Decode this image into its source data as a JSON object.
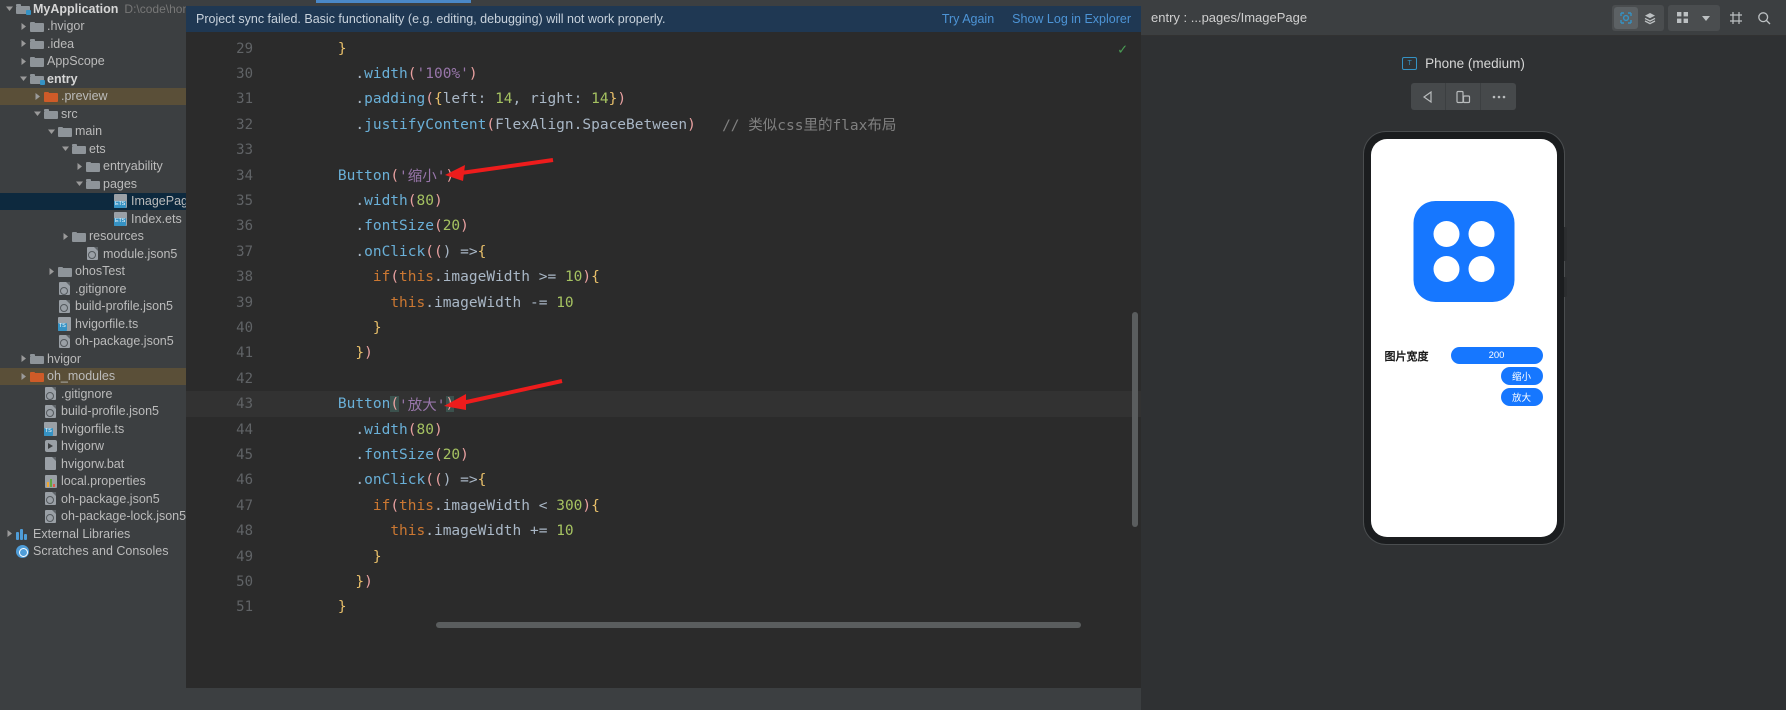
{
  "sidebar": {
    "items": [
      {
        "label": "MyApplication",
        "path": "D:\\code\\hong",
        "icon": "module-folder-icon",
        "indent": 0,
        "arrow": "down",
        "bold": true,
        "state": "none"
      },
      {
        "label": ".hvigor",
        "icon": "folder-icon",
        "indent": 1,
        "arrow": "right",
        "state": "none"
      },
      {
        "label": ".idea",
        "icon": "folder-icon",
        "indent": 1,
        "arrow": "right",
        "state": "none"
      },
      {
        "label": "AppScope",
        "icon": "folder-icon",
        "indent": 1,
        "arrow": "right",
        "state": "none"
      },
      {
        "label": "entry",
        "icon": "module-folder-icon",
        "indent": 1,
        "arrow": "down",
        "bold": true,
        "state": "none"
      },
      {
        "label": ".preview",
        "icon": "folder-orange-icon",
        "indent": 2,
        "arrow": "right",
        "state": "olive"
      },
      {
        "label": "src",
        "icon": "folder-icon",
        "indent": 2,
        "arrow": "down",
        "state": "none"
      },
      {
        "label": "main",
        "icon": "folder-icon",
        "indent": 3,
        "arrow": "down",
        "state": "none"
      },
      {
        "label": "ets",
        "icon": "folder-icon",
        "indent": 4,
        "arrow": "down",
        "state": "none"
      },
      {
        "label": "entryability",
        "icon": "folder-icon",
        "indent": 5,
        "arrow": "right",
        "state": "none"
      },
      {
        "label": "pages",
        "icon": "folder-icon",
        "indent": 5,
        "arrow": "down",
        "state": "none"
      },
      {
        "label": "ImagePage.",
        "icon": "ets-file-icon",
        "indent": 7,
        "arrow": "none",
        "state": "blue"
      },
      {
        "label": "Index.ets",
        "icon": "ets-file-icon",
        "indent": 7,
        "arrow": "none",
        "state": "none"
      },
      {
        "label": "resources",
        "icon": "folder-icon",
        "indent": 4,
        "arrow": "right",
        "state": "none"
      },
      {
        "label": "module.json5",
        "icon": "json5-file-icon",
        "indent": 5,
        "arrow": "none",
        "state": "none"
      },
      {
        "label": "ohosTest",
        "icon": "folder-icon",
        "indent": 3,
        "arrow": "right",
        "state": "none"
      },
      {
        "label": ".gitignore",
        "icon": "gitignore-file-icon",
        "indent": 3,
        "arrow": "none",
        "state": "none"
      },
      {
        "label": "build-profile.json5",
        "icon": "json5-file-icon",
        "indent": 3,
        "arrow": "none",
        "state": "none"
      },
      {
        "label": "hvigorfile.ts",
        "icon": "ts-file-icon",
        "indent": 3,
        "arrow": "none",
        "state": "none"
      },
      {
        "label": "oh-package.json5",
        "icon": "json5-file-icon",
        "indent": 3,
        "arrow": "none",
        "state": "none"
      },
      {
        "label": "hvigor",
        "icon": "folder-icon",
        "indent": 1,
        "arrow": "right",
        "state": "none"
      },
      {
        "label": "oh_modules",
        "icon": "folder-orange-icon",
        "indent": 1,
        "arrow": "right",
        "state": "olive"
      },
      {
        "label": ".gitignore",
        "icon": "gitignore-file-icon",
        "indent": 2,
        "arrow": "none",
        "state": "none"
      },
      {
        "label": "build-profile.json5",
        "icon": "json5-file-icon",
        "indent": 2,
        "arrow": "none",
        "state": "none"
      },
      {
        "label": "hvigorfile.ts",
        "icon": "ts-file-icon",
        "indent": 2,
        "arrow": "none",
        "state": "none"
      },
      {
        "label": "hvigorw",
        "icon": "run-file-icon",
        "indent": 2,
        "arrow": "none",
        "state": "none"
      },
      {
        "label": "hvigorw.bat",
        "icon": "bat-file-icon",
        "indent": 2,
        "arrow": "none",
        "state": "none"
      },
      {
        "label": "local.properties",
        "icon": "properties-file-icon",
        "indent": 2,
        "arrow": "none",
        "state": "none"
      },
      {
        "label": "oh-package.json5",
        "icon": "json5-file-icon",
        "indent": 2,
        "arrow": "none",
        "state": "none"
      },
      {
        "label": "oh-package-lock.json5",
        "icon": "json5-file-icon",
        "indent": 2,
        "arrow": "none",
        "state": "none"
      },
      {
        "label": "External Libraries",
        "icon": "external-libraries-icon",
        "indent": 0,
        "arrow": "right",
        "state": "none"
      },
      {
        "label": "Scratches and Consoles",
        "icon": "scratches-icon",
        "indent": 0,
        "arrow": "none",
        "state": "none"
      }
    ]
  },
  "notification": {
    "message": "Project sync failed. Basic functionality (e.g. editing, debugging) will not work properly.",
    "try_again": "Try Again",
    "show_log": "Show Log in Explorer"
  },
  "editor": {
    "lines": [
      {
        "n": "29",
        "fold": "end",
        "segments": [
          {
            "t": "    ",
            "c": "k-white"
          },
          {
            "t": "}",
            "c": "k-brkt-y"
          }
        ]
      },
      {
        "n": "30",
        "segments": [
          {
            "t": "      .",
            "c": "k-white"
          },
          {
            "t": "width",
            "c": "k-func"
          },
          {
            "t": "(",
            "c": "k-paren"
          },
          {
            "t": "'100%'",
            "c": "k-purple"
          },
          {
            "t": ")",
            "c": "k-paren"
          }
        ]
      },
      {
        "n": "31",
        "segments": [
          {
            "t": "      .",
            "c": "k-white"
          },
          {
            "t": "padding",
            "c": "k-func"
          },
          {
            "t": "(",
            "c": "k-paren"
          },
          {
            "t": "{",
            "c": "k-brkt-y"
          },
          {
            "t": "left",
            "c": "k-white"
          },
          {
            "t": ": ",
            "c": "k-white"
          },
          {
            "t": "14",
            "c": "k-brkt-g"
          },
          {
            "t": ", ",
            "c": "k-white"
          },
          {
            "t": "right",
            "c": "k-white"
          },
          {
            "t": ": ",
            "c": "k-white"
          },
          {
            "t": "14",
            "c": "k-brkt-g"
          },
          {
            "t": "}",
            "c": "k-brkt-y"
          },
          {
            "t": ")",
            "c": "k-paren"
          }
        ]
      },
      {
        "n": "32",
        "segments": [
          {
            "t": "      .",
            "c": "k-white"
          },
          {
            "t": "justifyContent",
            "c": "k-func"
          },
          {
            "t": "(",
            "c": "k-paren"
          },
          {
            "t": "FlexAlign",
            "c": "k-white"
          },
          {
            "t": ".",
            "c": "k-white"
          },
          {
            "t": "SpaceBetween",
            "c": "k-white"
          },
          {
            "t": ")",
            "c": "k-paren"
          },
          {
            "t": "   ",
            "c": "k-white"
          },
          {
            "t": "// 类似css里的flax布局",
            "c": "k-gray"
          }
        ]
      },
      {
        "n": "33",
        "segments": []
      },
      {
        "n": "34",
        "segments": [
          {
            "t": "    ",
            "c": "k-white"
          },
          {
            "t": "Button",
            "c": "k-func"
          },
          {
            "t": "(",
            "c": "k-paren"
          },
          {
            "t": "'缩小'",
            "c": "k-purple"
          },
          {
            "t": ")",
            "c": "k-paren"
          }
        ],
        "arrow": true
      },
      {
        "n": "35",
        "segments": [
          {
            "t": "      .",
            "c": "k-white"
          },
          {
            "t": "width",
            "c": "k-func"
          },
          {
            "t": "(",
            "c": "k-paren"
          },
          {
            "t": "80",
            "c": "k-brkt-g"
          },
          {
            "t": ")",
            "c": "k-paren"
          }
        ]
      },
      {
        "n": "36",
        "segments": [
          {
            "t": "      .",
            "c": "k-white"
          },
          {
            "t": "fontSize",
            "c": "k-func"
          },
          {
            "t": "(",
            "c": "k-paren"
          },
          {
            "t": "20",
            "c": "k-brkt-g"
          },
          {
            "t": ")",
            "c": "k-paren"
          }
        ]
      },
      {
        "n": "37",
        "fold": "start",
        "segments": [
          {
            "t": "      .",
            "c": "k-white"
          },
          {
            "t": "onClick",
            "c": "k-func"
          },
          {
            "t": "((",
            "c": "k-paren"
          },
          {
            "t": ") =>",
            "c": "k-white"
          },
          {
            "t": "{",
            "c": "k-brkt-y"
          }
        ]
      },
      {
        "n": "38",
        "fold": "start",
        "segments": [
          {
            "t": "        ",
            "c": "k-white"
          },
          {
            "t": "if",
            "c": "k-orange"
          },
          {
            "t": "(",
            "c": "k-paren"
          },
          {
            "t": "this",
            "c": "k-orange"
          },
          {
            "t": ".",
            "c": "k-white"
          },
          {
            "t": "imageWidth",
            "c": "k-white"
          },
          {
            "t": " >= ",
            "c": "k-white"
          },
          {
            "t": "10",
            "c": "k-brkt-g"
          },
          {
            "t": ")",
            "c": "k-paren"
          },
          {
            "t": "{",
            "c": "k-brkt-y"
          }
        ]
      },
      {
        "n": "39",
        "segments": [
          {
            "t": "          ",
            "c": "k-white"
          },
          {
            "t": "this",
            "c": "k-orange"
          },
          {
            "t": ".",
            "c": "k-white"
          },
          {
            "t": "imageWidth",
            "c": "k-white"
          },
          {
            "t": " -= ",
            "c": "k-white"
          },
          {
            "t": "10",
            "c": "k-brkt-g"
          }
        ]
      },
      {
        "n": "40",
        "segments": [
          {
            "t": "        ",
            "c": "k-white"
          },
          {
            "t": "}",
            "c": "k-brkt-y"
          }
        ]
      },
      {
        "n": "41",
        "fold": "end",
        "segments": [
          {
            "t": "      ",
            "c": "k-white"
          },
          {
            "t": "}",
            "c": "k-brkt-y"
          },
          {
            "t": ")",
            "c": "k-paren"
          }
        ]
      },
      {
        "n": "42",
        "segments": []
      },
      {
        "n": "43",
        "bulb": true,
        "highlight": true,
        "segments": [
          {
            "t": "    ",
            "c": "k-white"
          },
          {
            "t": "Button",
            "c": "k-func"
          },
          {
            "t": "(",
            "c": "k-paren hl-brkt"
          },
          {
            "t": "'放大'",
            "c": "k-purple"
          },
          {
            "t": ")",
            "c": "k-paren hl-brkt"
          }
        ],
        "arrow": true
      },
      {
        "n": "44",
        "segments": [
          {
            "t": "      .",
            "c": "k-white"
          },
          {
            "t": "width",
            "c": "k-func"
          },
          {
            "t": "(",
            "c": "k-paren"
          },
          {
            "t": "80",
            "c": "k-brkt-g"
          },
          {
            "t": ")",
            "c": "k-paren"
          }
        ]
      },
      {
        "n": "45",
        "segments": [
          {
            "t": "      .",
            "c": "k-white"
          },
          {
            "t": "fontSize",
            "c": "k-func"
          },
          {
            "t": "(",
            "c": "k-paren"
          },
          {
            "t": "20",
            "c": "k-brkt-g"
          },
          {
            "t": ")",
            "c": "k-paren"
          }
        ]
      },
      {
        "n": "46",
        "fold": "start",
        "segments": [
          {
            "t": "      .",
            "c": "k-white"
          },
          {
            "t": "onClick",
            "c": "k-func"
          },
          {
            "t": "((",
            "c": "k-paren"
          },
          {
            "t": ") =>",
            "c": "k-white"
          },
          {
            "t": "{",
            "c": "k-brkt-y"
          }
        ]
      },
      {
        "n": "47",
        "fold": "start",
        "segments": [
          {
            "t": "        ",
            "c": "k-white"
          },
          {
            "t": "if",
            "c": "k-orange"
          },
          {
            "t": "(",
            "c": "k-paren"
          },
          {
            "t": "this",
            "c": "k-orange"
          },
          {
            "t": ".",
            "c": "k-white"
          },
          {
            "t": "imageWidth",
            "c": "k-white"
          },
          {
            "t": " < ",
            "c": "k-white"
          },
          {
            "t": "300",
            "c": "k-brkt-g"
          },
          {
            "t": ")",
            "c": "k-paren"
          },
          {
            "t": "{",
            "c": "k-brkt-y"
          }
        ]
      },
      {
        "n": "48",
        "segments": [
          {
            "t": "          ",
            "c": "k-white"
          },
          {
            "t": "this",
            "c": "k-orange"
          },
          {
            "t": ".",
            "c": "k-white"
          },
          {
            "t": "imageWidth",
            "c": "k-white"
          },
          {
            "t": " += ",
            "c": "k-white"
          },
          {
            "t": "10",
            "c": "k-brkt-g"
          }
        ]
      },
      {
        "n": "49",
        "segments": [
          {
            "t": "        ",
            "c": "k-white"
          },
          {
            "t": "}",
            "c": "k-brkt-y"
          }
        ]
      },
      {
        "n": "50",
        "fold": "end",
        "segments": [
          {
            "t": "      ",
            "c": "k-white"
          },
          {
            "t": "}",
            "c": "k-brkt-y"
          },
          {
            "t": ")",
            "c": "k-paren"
          }
        ]
      },
      {
        "n": "51",
        "fold": "end",
        "segments": [
          {
            "t": "    ",
            "c": "k-white"
          },
          {
            "t": "}",
            "c": "k-brkt-y"
          }
        ]
      }
    ]
  },
  "preview": {
    "title": "entry : ...pages/ImagePage",
    "device_label": "Phone (medium)",
    "device_chip": "T",
    "screen": {
      "width_label": "图片宽度",
      "width_value": "200",
      "shrink_button": "缩小",
      "enlarge_button": "放大"
    }
  },
  "colors": {
    "accent_blue": "#1677ff",
    "link_blue": "#4d94d6",
    "notify_bg": "#1f3853",
    "editor_bg": "#2b2b2b",
    "panel_bg": "#3c3f41"
  }
}
